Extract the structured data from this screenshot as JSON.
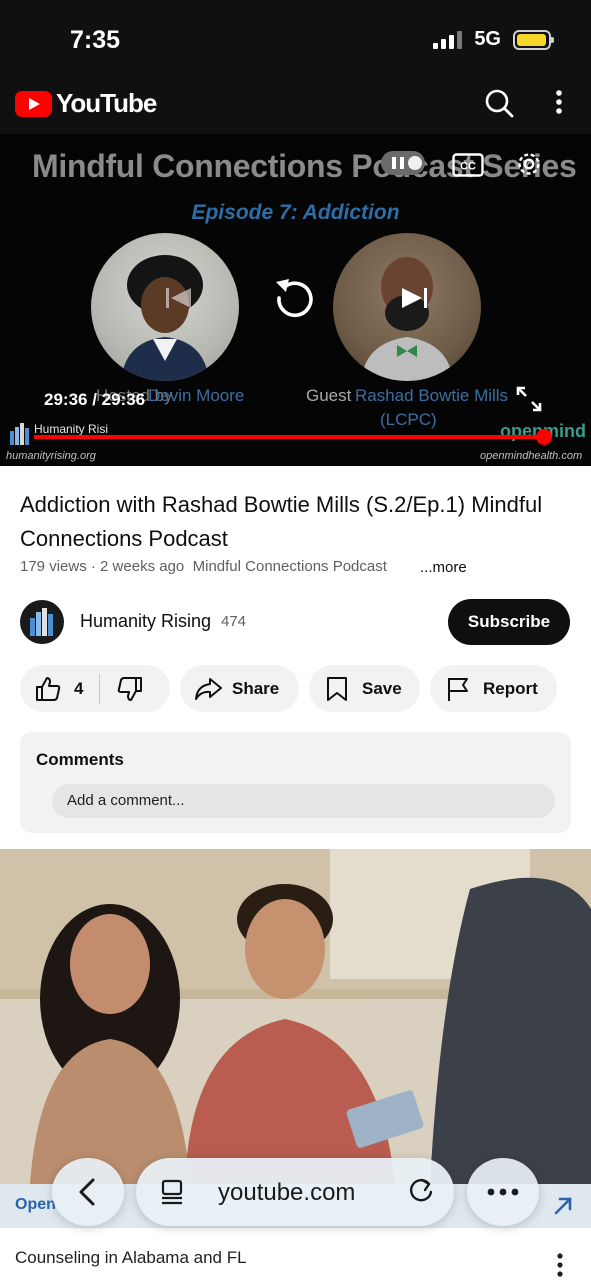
{
  "status_bar": {
    "time": "7:35",
    "network": "5G",
    "battery_fill": 0.95
  },
  "header": {
    "logo_text": "YouTube",
    "icons": [
      "search-icon",
      "more-vertical-icon"
    ]
  },
  "player": {
    "overlay_title": "Mindful Connections Podcast Series",
    "episode": "Episode 7: Addiction",
    "host_label": "Hosted by",
    "host_name": "Devin Moore",
    "guest_label": "Guest",
    "guest_name": "Rashad Bowtie Mills",
    "guest_creds": "(LCPC)",
    "timecode": "29:36 / 29:36",
    "progress": 1.0,
    "watermark_left_name": "Humanity Rising",
    "watermark_left_url": "humanityrising.org",
    "watermark_right_name": "openmind",
    "watermark_right_url": "openmindhealth.com",
    "accent_color": "#ff0000",
    "icons": [
      "pause-icon",
      "closed-captions-icon",
      "settings-gear-icon",
      "previous-icon",
      "replay-icon",
      "next-icon",
      "fullscreen-icon"
    ]
  },
  "video": {
    "title": "Addiction with Rashad Bowtie Mills (S.2/Ep.1) Mindful Connections Podcast",
    "views": "179 views",
    "age": "2 weeks ago",
    "meta_channel": "Mindful Connections Podcast",
    "more_label": "...more"
  },
  "channel": {
    "name": "Humanity Rising",
    "subscribers": "474",
    "subscribe_label": "Subscribe"
  },
  "actions": {
    "like_count": "4",
    "share_label": "Share",
    "save_label": "Save",
    "report_label": "Report"
  },
  "comments": {
    "title": "Comments",
    "placeholder": "Add a comment..."
  },
  "ad": {
    "brand": "Open",
    "title": "Counseling in Alabama and FL"
  },
  "browser": {
    "url": "youtube.com"
  }
}
